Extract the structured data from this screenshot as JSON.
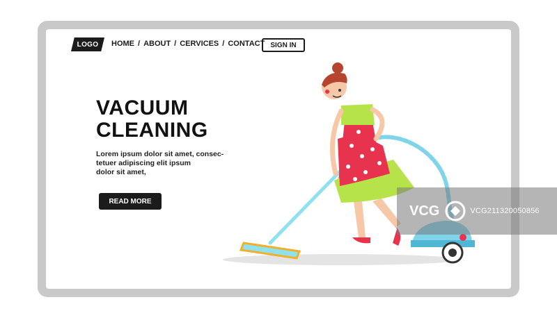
{
  "header": {
    "logo": "LOGO",
    "nav": [
      {
        "label": "HOME"
      },
      {
        "label": "ABOUT"
      },
      {
        "label": "CERVICES"
      },
      {
        "label": "CONTACT"
      }
    ],
    "separator": "/",
    "signin_label": "SIGN IN"
  },
  "hero": {
    "title_line1": "VACUUM",
    "title_line2": "CLEANING",
    "body_lines": [
      "Lorem ipsum dolor sit amet, consec-",
      "tetuer adipiscing elit ipsum",
      "dolor sit amet,"
    ],
    "button_label": "READ MORE"
  },
  "watermark": {
    "brand": "VCG",
    "id": "VCG211320050856"
  },
  "colors": {
    "frame": "#c9c9c9",
    "dark": "#1b1b1b",
    "dress": "#e8334f",
    "apron": "#b6e34a",
    "vacuum": "#7fd4ea"
  }
}
